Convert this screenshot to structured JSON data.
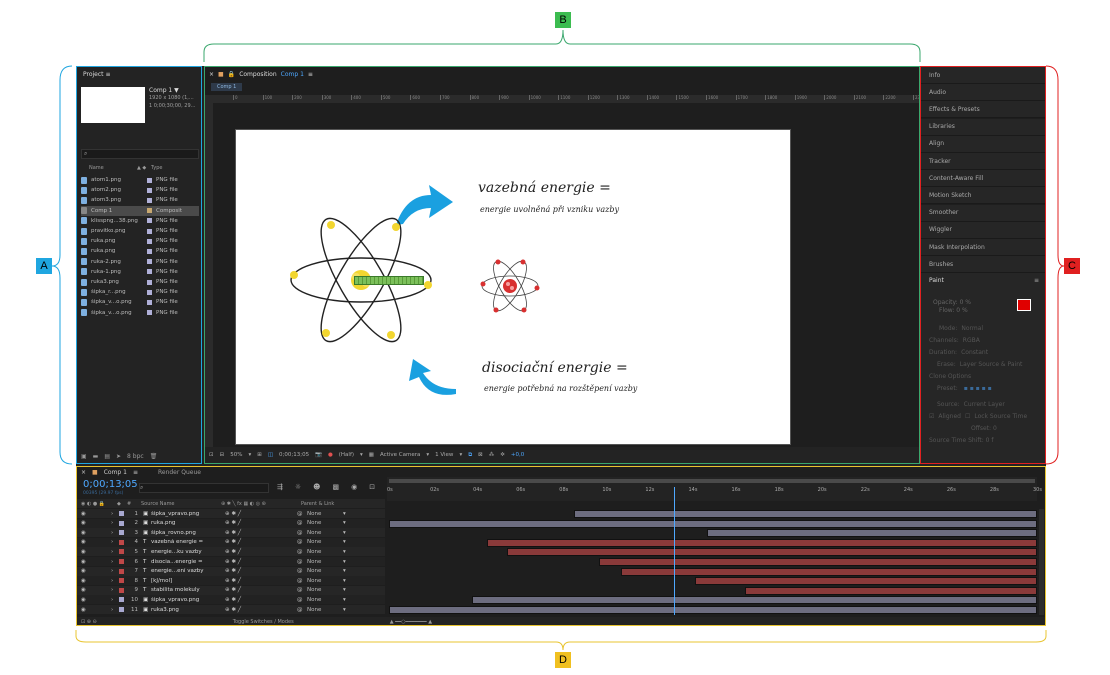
{
  "annotations": {
    "a": "A",
    "b": "B",
    "c": "C",
    "d": "D"
  },
  "colors": {
    "a": "#1fa6e0",
    "b": "#3aa76d",
    "c": "#e02020",
    "d": "#e8c430",
    "bg": "#232323"
  },
  "project": {
    "title": "Project",
    "comp_name": "Comp 1 ▼",
    "comp_res": "1920 x 1080 (1,...",
    "comp_dur": "1 0;00;30;00, 29...",
    "col_name": "Name",
    "col_type": "Type",
    "files": [
      {
        "name": "atom1.png",
        "type": "PNG file"
      },
      {
        "name": "atom2.png",
        "type": "PNG file"
      },
      {
        "name": "atom3.png",
        "type": "PNG file"
      },
      {
        "name": "Comp 1",
        "type": "Composit"
      },
      {
        "name": "klisspng...38.png",
        "type": "PNG file"
      },
      {
        "name": "pravitko.png",
        "type": "PNG file"
      },
      {
        "name": "ruka.png",
        "type": "PNG file"
      },
      {
        "name": "ruka.png",
        "type": "PNG file"
      },
      {
        "name": "ruka-2.png",
        "type": "PNG file"
      },
      {
        "name": "ruka-1.png",
        "type": "PNG file"
      },
      {
        "name": "ruka3.png",
        "type": "PNG file"
      },
      {
        "name": "šipka_r...png",
        "type": "PNG file"
      },
      {
        "name": "šipka_v...o.png",
        "type": "PNG file"
      },
      {
        "name": "šipka_v...o.png",
        "type": "PNG file"
      }
    ],
    "bpc": "8 bpc"
  },
  "composition": {
    "title": "Composition",
    "comp_link": "Comp 1",
    "tab": "Comp 1",
    "ruler_ticks": [
      "0",
      "100",
      "200",
      "300",
      "400",
      "500",
      "600",
      "700",
      "800",
      "900",
      "1000",
      "1100",
      "1200",
      "1300",
      "1400",
      "1500",
      "1600",
      "1700",
      "1800",
      "1900",
      "2000",
      "2100",
      "2200",
      "2300"
    ],
    "text1": "vazebná energie =",
    "text1_sub": "energie uvolněná při vzniku vazby",
    "text2": "disociační energie =",
    "text2_sub": "energie potřebná na rozštěpení vazby",
    "zoom": "50%",
    "time": "0;00;13;05",
    "resolution": "(Half)",
    "camera": "Active Camera",
    "view": "1 View",
    "exposure": "+0,0"
  },
  "right_panels": [
    "Info",
    "Audio",
    "Effects & Presets",
    "Libraries",
    "Align",
    "Tracker",
    "Content-Aware Fill",
    "Motion Sketch",
    "Smoother",
    "Wiggler",
    "Mask Interpolation",
    "Brushes"
  ],
  "paint": {
    "title": "Paint",
    "opacity": "Opacity: 0 %",
    "flow": "Flow: 0 %",
    "mode_label": "Mode:",
    "mode": "Normal",
    "channels_label": "Channels:",
    "channels": "RGBA",
    "duration_label": "Duration:",
    "duration": "Constant",
    "erase_label": "Erase:",
    "erase": "Layer Source & Paint",
    "clone_options": "Clone Options",
    "preset_label": "Preset:",
    "source_label": "Source:",
    "source": "Current Layer",
    "aligned": "Aligned",
    "lock_source": "Lock Source Time",
    "offset": "Offset: 0",
    "source_time_shift": "Source Time Shift: 0 f"
  },
  "timeline": {
    "tab": "Comp 1",
    "render_queue": "Render Queue",
    "timecode": "0;00;13;05",
    "fps": "00395 (29.97 fps)",
    "col_num": "#",
    "col_source": "Source Name",
    "col_parent": "Parent & Link",
    "toggle": "Toggle Switches / Modes",
    "ticks": [
      "0s",
      "02s",
      "04s",
      "06s",
      "08s",
      "10s",
      "12s",
      "14s",
      "16s",
      "18s",
      "20s",
      "22s",
      "24s",
      "26s",
      "28s",
      "30s"
    ],
    "layers": [
      {
        "num": "1",
        "kind": "img",
        "name": "šipka_vpravo.png",
        "parent": "None",
        "color": "#a8a8d0",
        "start": 0.286,
        "end": 1.0,
        "bar": "#6d6d80"
      },
      {
        "num": "2",
        "kind": "img",
        "name": "ruka.png",
        "parent": "None",
        "color": "#a8a8d0",
        "start": 0.0,
        "end": 1.0,
        "bar": "#6d6d80"
      },
      {
        "num": "3",
        "kind": "img",
        "name": "šipka_rovno.png",
        "parent": "None",
        "color": "#a8a8d0",
        "start": 0.49,
        "end": 1.0,
        "bar": "#6d6d80"
      },
      {
        "num": "4",
        "kind": "T",
        "name": "vazebná energie =",
        "parent": "None",
        "color": "#c04848",
        "start": 0.152,
        "end": 1.0,
        "bar": "#8a3a3a"
      },
      {
        "num": "5",
        "kind": "T",
        "name": "energie...ku vazby",
        "parent": "None",
        "color": "#c04848",
        "start": 0.182,
        "end": 1.0,
        "bar": "#8a3a3a"
      },
      {
        "num": "6",
        "kind": "T",
        "name": "disocia...energie =",
        "parent": "None",
        "color": "#c04848",
        "start": 0.324,
        "end": 1.0,
        "bar": "#8a3a3a"
      },
      {
        "num": "7",
        "kind": "T",
        "name": "energie...ení vazby",
        "parent": "None",
        "color": "#c04848",
        "start": 0.358,
        "end": 1.0,
        "bar": "#8a3a3a"
      },
      {
        "num": "8",
        "kind": "T",
        "name": "[kJ/mol]",
        "parent": "None",
        "color": "#c04848",
        "start": 0.472,
        "end": 1.0,
        "bar": "#8a3a3a"
      },
      {
        "num": "9",
        "kind": "T",
        "name": "stabilita molekuly",
        "parent": "None",
        "color": "#c04848",
        "start": 0.55,
        "end": 1.0,
        "bar": "#8a3a3a"
      },
      {
        "num": "10",
        "kind": "img",
        "name": "šipka_vpravo.png",
        "parent": "None",
        "color": "#a8a8d0",
        "start": 0.128,
        "end": 1.0,
        "bar": "#6d6d80"
      },
      {
        "num": "11",
        "kind": "img",
        "name": "ruka3.png",
        "parent": "None",
        "color": "#a8a8d0",
        "start": 0.0,
        "end": 1.0,
        "bar": "#6d6d80"
      }
    ],
    "playhead": 0.44
  }
}
